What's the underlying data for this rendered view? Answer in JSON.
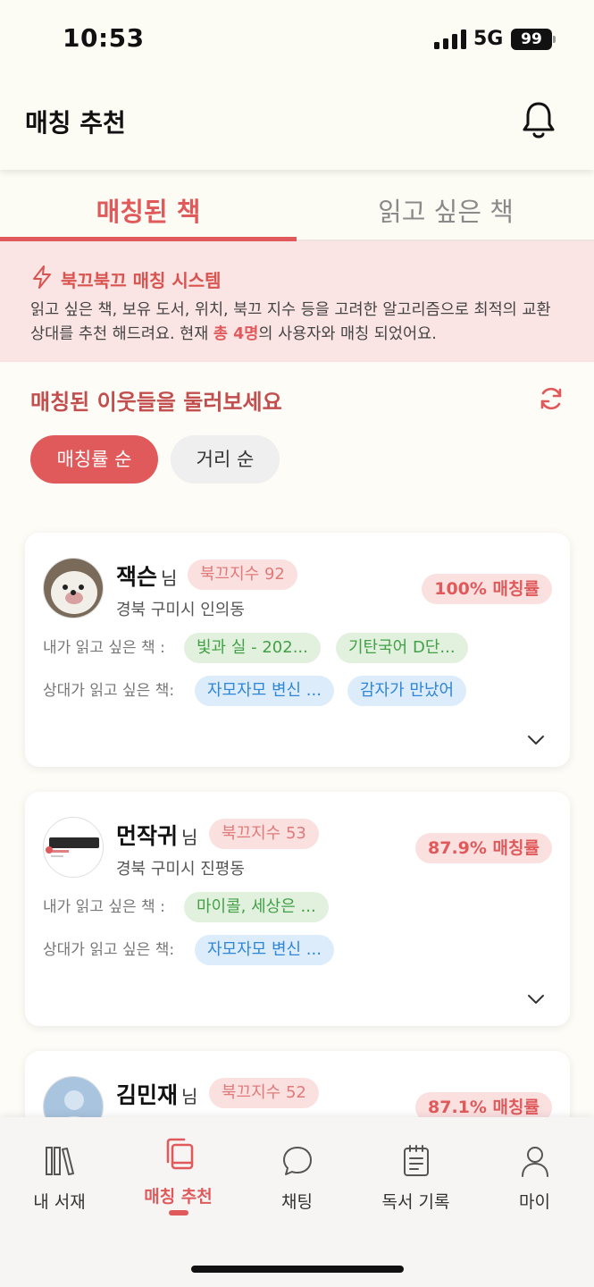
{
  "status_bar": {
    "time": "10:53",
    "network": "5G",
    "battery": "99"
  },
  "header": {
    "title": "매칭 추천"
  },
  "tabs": [
    {
      "label": "매칭된 책",
      "active": true
    },
    {
      "label": "읽고 싶은 책",
      "active": false
    }
  ],
  "info": {
    "title": "북끄북끄 매칭 시스템",
    "text_before": "읽고 싶은 책, 보유 도서, 위치, 북끄 지수 등을 고려한 알고리즘으로 최적의 교환 상대를 추천 해드려요. 현재 ",
    "highlight": "총 4명",
    "text_after": "의 사용자와 매칭 되었어요."
  },
  "section": {
    "title": "매칭된 이웃들을 둘러보세요"
  },
  "sort": {
    "options": [
      "매칭률 순",
      "거리 순"
    ],
    "selected": "매칭률 순"
  },
  "labels": {
    "my_wish": "내가 읽고 싶은 책 :",
    "their_wish": "상대가 읽고 싶은 책:",
    "suffix": "님"
  },
  "matches": [
    {
      "name": "잭슨",
      "score": "북끄지수 92",
      "location": "경북 구미시 인의동",
      "match_rate": "100% 매칭률",
      "my_wish_books": [
        "빛과 실 - 202...",
        "기탄국어 D단..."
      ],
      "their_wish_books": [
        "자모자모 변신 ...",
        "감자가 만났어"
      ]
    },
    {
      "name": "먼작귀",
      "score": "북끄지수 53",
      "location": "경북 구미시 진평동",
      "match_rate": "87.9% 매칭률",
      "my_wish_books": [
        "마이콜, 세상은 ..."
      ],
      "their_wish_books": [
        "자모자모 변신 ..."
      ]
    },
    {
      "name": "김민재",
      "score": "북끄지수 52",
      "location": "",
      "match_rate": "87.1% 매칭률",
      "my_wish_books": [],
      "their_wish_books": []
    }
  ],
  "bottom_nav": [
    {
      "label": "내 서재",
      "icon": "bookshelf-icon",
      "active": false
    },
    {
      "label": "매칭 추천",
      "icon": "matching-icon",
      "active": true
    },
    {
      "label": "채팅",
      "icon": "chat-bubble-icon",
      "active": false
    },
    {
      "label": "독서 기록",
      "icon": "notepad-icon",
      "active": false
    },
    {
      "label": "마이",
      "icon": "person-icon",
      "active": false
    }
  ],
  "colors": {
    "accent": "#e05a5c",
    "background": "#fdfcf7",
    "green_tag": "#43a047",
    "blue_tag": "#2f86d6"
  }
}
